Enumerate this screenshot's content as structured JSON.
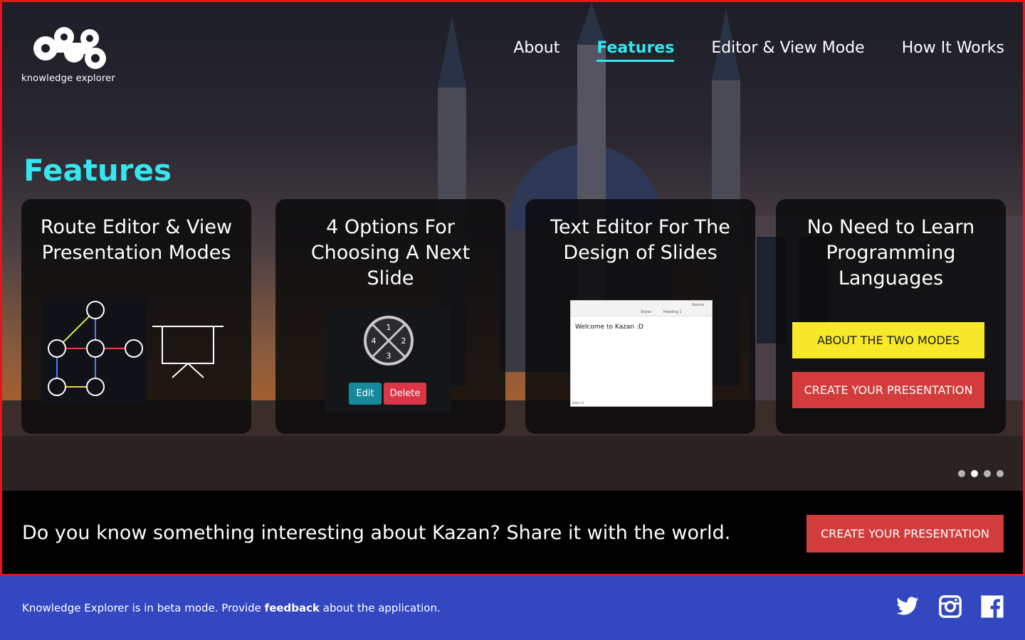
{
  "brand": {
    "name": "knowledge explorer"
  },
  "nav": {
    "items": [
      {
        "label": "About",
        "active": false
      },
      {
        "label": "Features",
        "active": true
      },
      {
        "label": "Editor & View Mode",
        "active": false
      },
      {
        "label": "How It Works",
        "active": false
      }
    ]
  },
  "section": {
    "title": "Features"
  },
  "cards": [
    {
      "title": "Route Editor & View Presentation Modes",
      "icons": [
        "route-graph-icon",
        "presentation-board-icon"
      ]
    },
    {
      "title": "4 Options For Choosing A Next Slide",
      "options": [
        "1",
        "2",
        "3",
        "4"
      ],
      "edit_label": "Edit",
      "delete_label": "Delete"
    },
    {
      "title": "Text Editor For The Design of Slides",
      "editor": {
        "content": "Welcome to Kazan :D",
        "styles_label": "Styles",
        "heading_label": "Heading 1",
        "source_label": "Source",
        "status": "body  h1"
      }
    },
    {
      "title": "No Need to Learn Programming Languages",
      "about_button": "ABOUT THE TWO MODES",
      "create_button": "CREATE YOUR PRESENTATION"
    }
  ],
  "carousel": {
    "total": 4,
    "active_index": 1
  },
  "cta": {
    "text": "Do you know something interesting about Kazan? Share it with the world.",
    "button": "CREATE YOUR PRESENTATION"
  },
  "footer": {
    "text_before": "Knowledge Explorer is in beta mode. Provide ",
    "link": "feedback",
    "text_after": " about the application.",
    "social": [
      "twitter-icon",
      "instagram-icon",
      "facebook-icon"
    ]
  },
  "colors": {
    "accent": "#34e6ef",
    "yellow_button": "#f7e92a",
    "red_button": "#d23c3c",
    "footer_bg": "#3347c1",
    "frame_border": "#e8141c"
  }
}
